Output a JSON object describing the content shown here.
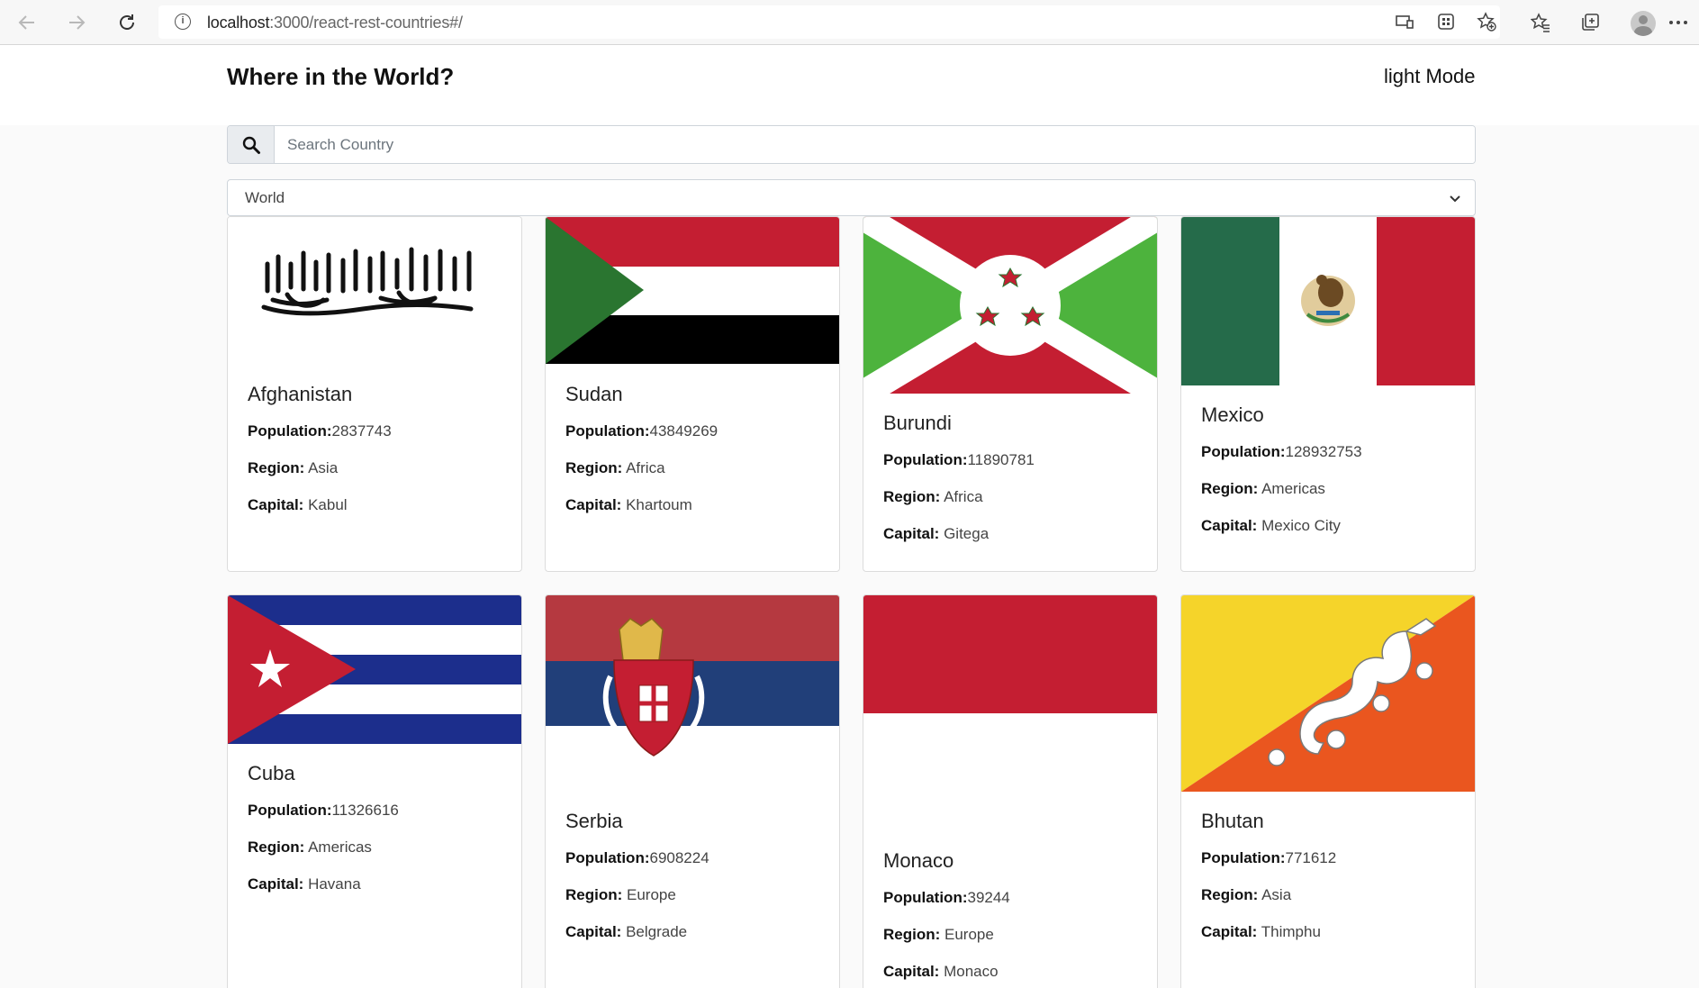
{
  "browser": {
    "url_host": "localhost",
    "url_rest": ":3000/react-rest-countries#/"
  },
  "header": {
    "title": "Where in the World?",
    "mode_label": "light Mode"
  },
  "search": {
    "placeholder": "Search Country"
  },
  "filter": {
    "selected": "World"
  },
  "labels": {
    "population": "Population:",
    "region": "Region:",
    "capital": "Capital:"
  },
  "countries": [
    {
      "name": "Afghanistan",
      "population": "2837743",
      "region": "Asia",
      "capital": "Kabul"
    },
    {
      "name": "Sudan",
      "population": "43849269",
      "region": "Africa",
      "capital": "Khartoum"
    },
    {
      "name": "Burundi",
      "population": "11890781",
      "region": "Africa",
      "capital": "Gitega"
    },
    {
      "name": "Mexico",
      "population": "128932753",
      "region": "Americas",
      "capital": "Mexico City"
    },
    {
      "name": "Cuba",
      "population": "11326616",
      "region": "Americas",
      "capital": "Havana"
    },
    {
      "name": "Serbia",
      "population": "6908224",
      "region": "Europe",
      "capital": "Belgrade"
    },
    {
      "name": "Monaco",
      "population": "39244",
      "region": "Europe",
      "capital": "Monaco"
    },
    {
      "name": "Bhutan",
      "population": "771612",
      "region": "Asia",
      "capital": "Thimphu"
    }
  ],
  "colors": {
    "page_bg": "#fafafa",
    "card_border": "#dcdcdc",
    "sudan_red": "#c41e32",
    "sudan_green": "#2a7530",
    "burundi_green": "#4db33d",
    "mexico_green": "#256b4a",
    "cuba_blue": "#1c2e8c",
    "serbia_red": "#b53940",
    "serbia_blue": "#213f79",
    "bhutan_yellow": "#f5d42a",
    "bhutan_orange": "#ea561f"
  }
}
